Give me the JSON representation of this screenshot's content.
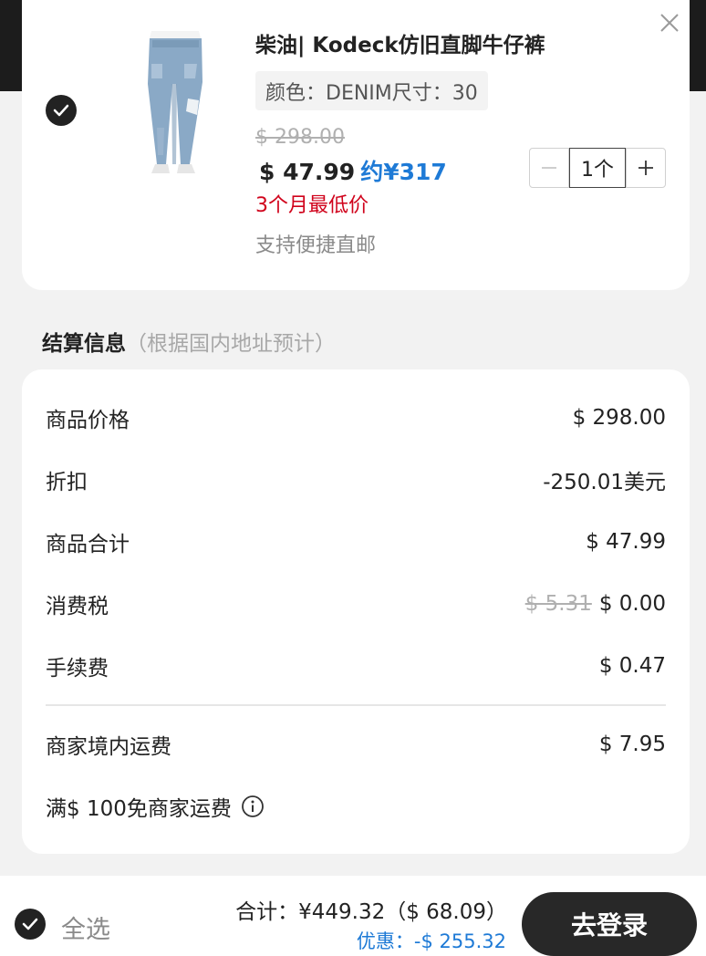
{
  "product": {
    "title": "柴油| Kodeck仿旧直脚牛仔裤",
    "variant": "颜色：DENIM尺寸：30",
    "original_price": "$ 298.00",
    "sale_price": "$ 47.99",
    "cny_price": "约¥317",
    "low_price_note": "3个月最低价",
    "shipping_note": "支持便捷直邮",
    "quantity": "1个",
    "selected": true
  },
  "settlement": {
    "title": "结算信息",
    "subtitle": "（根据国内地址预计）",
    "rows": [
      {
        "label": "商品价格",
        "value": "$ 298.00"
      },
      {
        "label": "折扣",
        "value": "-250.01美元"
      },
      {
        "label": "商品合计",
        "value": "$ 47.99"
      },
      {
        "label": "消费税",
        "strike_value": "$ 5.31",
        "value": "$ 0.00"
      },
      {
        "label": "手续费",
        "value": "$ 0.47"
      },
      {
        "label": "商家境内运费",
        "value": "$ 7.95"
      }
    ],
    "free_shipping_note": "满$ 100免商家运费"
  },
  "bottom": {
    "select_all": "全选",
    "total": "合计：¥449.32（$ 68.09）",
    "discount": "优惠：-$ 255.32",
    "login_button": "去登录"
  },
  "colors": {
    "accent_blue": "#1e7ad6",
    "price_red": "#d0021b",
    "dark": "#222222"
  },
  "icons": {
    "close": "close-icon",
    "check": "checkmark-icon",
    "minus": "minus-icon",
    "plus": "plus-icon",
    "info": "info-icon"
  }
}
